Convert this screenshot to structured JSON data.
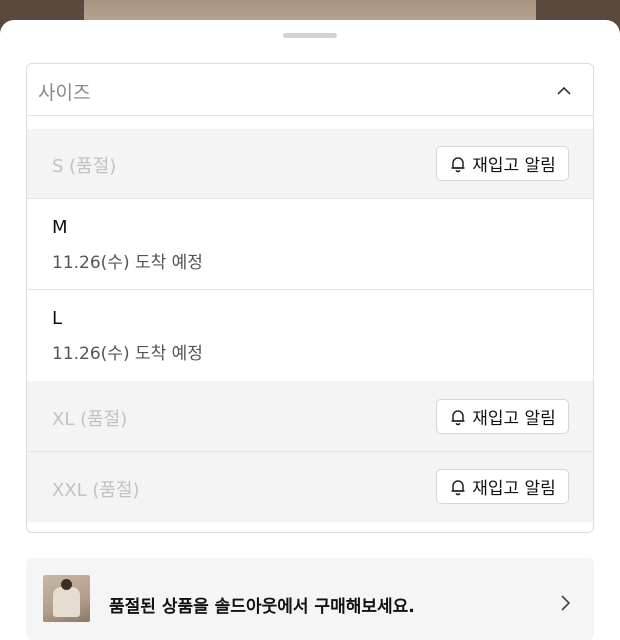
{
  "dropdown": {
    "label": "사이즈"
  },
  "options": [
    {
      "label": "S (품절)",
      "soldout": true,
      "button": "재입고 알림"
    },
    {
      "label": "M",
      "soldout": false,
      "arrival": "11.26(수) 도착 예정"
    },
    {
      "label": "L",
      "soldout": false,
      "arrival": "11.26(수) 도착 예정"
    },
    {
      "label": "XL (품절)",
      "soldout": true,
      "button": "재입고 알림"
    },
    {
      "label": "XXL (품절)",
      "soldout": true,
      "button": "재입고 알림"
    }
  ],
  "banner": {
    "text": "품절된 상품을 솔드아웃에서 구매해보세요."
  },
  "icons": {
    "dropdown_toggle": "chevron-up-icon",
    "restock": "bell-icon",
    "banner_arrow": "chevron-right-icon"
  },
  "colors": {
    "soldout_row_bg": "#f4f4f4",
    "soldout_text": "#c2c2c2",
    "banner_bg": "#f5f5f5"
  }
}
